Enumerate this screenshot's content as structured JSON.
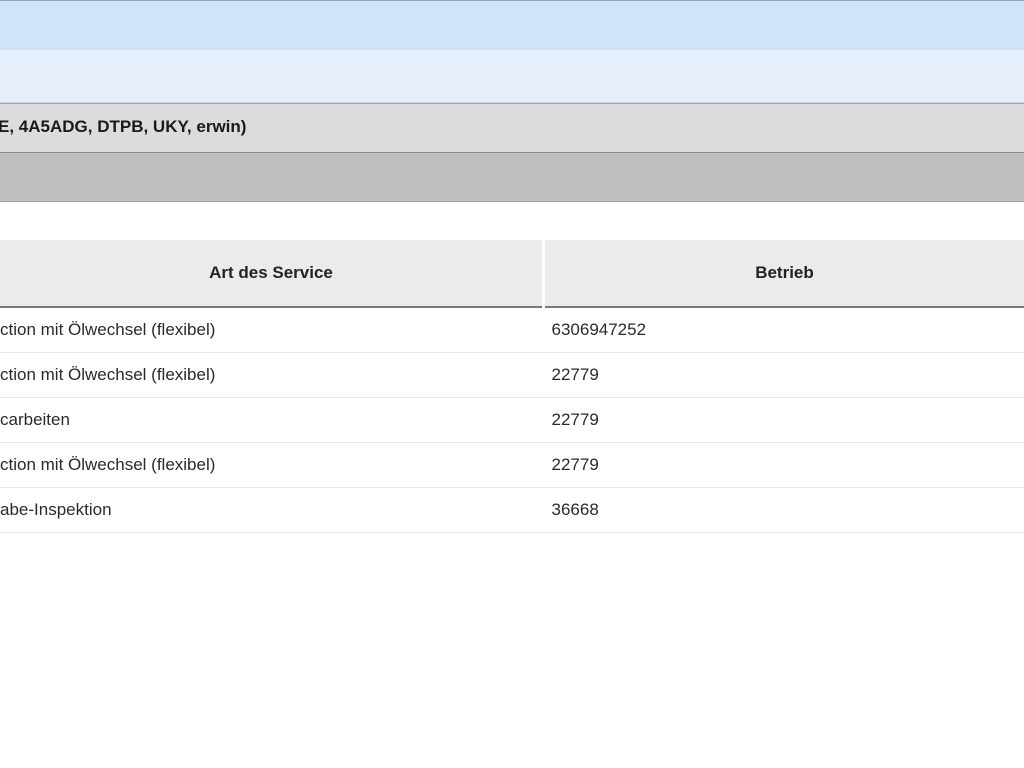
{
  "vehicle_info": "E, 4A5ADG, DTPB, UKY, erwin)",
  "table": {
    "headers": [
      "Art des Service",
      "Betrieb"
    ],
    "rows": [
      {
        "service": "ction mit Ölwechsel (flexibel)",
        "betrieb": "6306947252"
      },
      {
        "service": "ction mit Ölwechsel (flexibel)",
        "betrieb": "22779"
      },
      {
        "service": "carbeiten",
        "betrieb": "22779"
      },
      {
        "service": "ction mit Ölwechsel (flexibel)",
        "betrieb": "22779"
      },
      {
        "service": "abe-Inspektion",
        "betrieb": "36668"
      }
    ]
  }
}
